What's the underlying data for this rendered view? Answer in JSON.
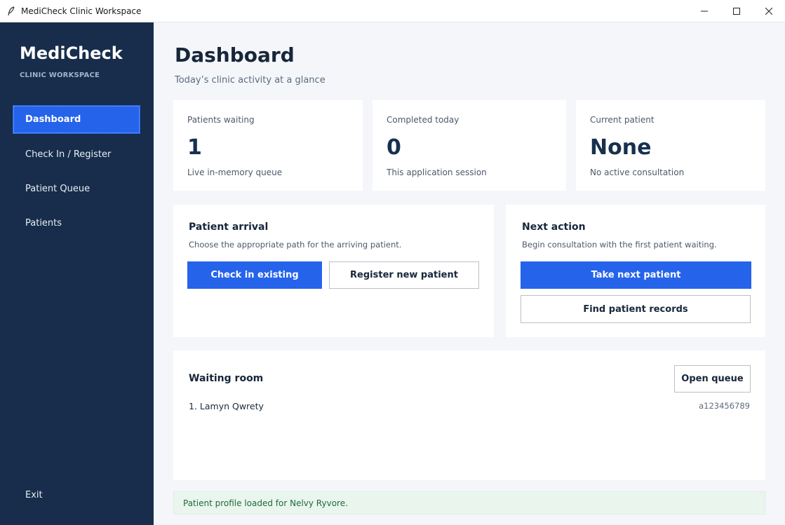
{
  "window": {
    "title": "MediCheck Clinic Workspace",
    "icon": "feather-icon"
  },
  "sidebar": {
    "brand": "MediCheck",
    "brand_sub": "CLINIC WORKSPACE",
    "items": [
      {
        "label": "Dashboard",
        "active": true
      },
      {
        "label": "Check In / Register",
        "active": false
      },
      {
        "label": "Patient Queue",
        "active": false
      },
      {
        "label": "Patients",
        "active": false
      }
    ],
    "exit_label": "Exit"
  },
  "header": {
    "title": "Dashboard",
    "subtitle": "Today’s clinic activity at a glance"
  },
  "stats": [
    {
      "label": "Patients waiting",
      "value": "1",
      "note": "Live in-memory queue"
    },
    {
      "label": "Completed today",
      "value": "0",
      "note": "This application session"
    },
    {
      "label": "Current patient",
      "value": "None",
      "note": "No active consultation"
    }
  ],
  "arrival": {
    "title": "Patient arrival",
    "subtitle": "Choose the appropriate path for the arriving patient.",
    "primary_label": "Check in existing",
    "secondary_label": "Register new patient"
  },
  "next_action": {
    "title": "Next action",
    "subtitle": "Begin consultation with the first patient waiting.",
    "primary_label": "Take next patient",
    "secondary_label": "Find patient records"
  },
  "waiting_room": {
    "title": "Waiting room",
    "open_label": "Open queue",
    "rows": [
      {
        "name": "1.  Lamyn Qwrety",
        "id": "a123456789"
      }
    ]
  },
  "status": {
    "message": "Patient profile loaded for Nelvy Ryvore."
  },
  "colors": {
    "sidebar_bg": "#172d4b",
    "accent": "#2563eb",
    "page_bg": "#f4f6fa",
    "status_bg": "#eaf5ee",
    "status_text": "#1f6b3a"
  }
}
